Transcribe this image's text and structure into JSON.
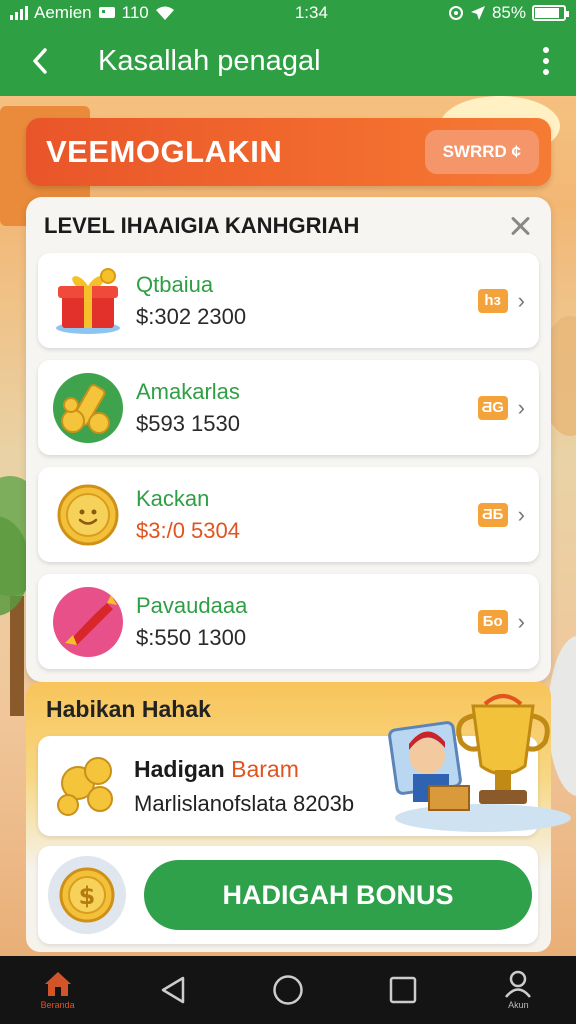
{
  "status_bar": {
    "carrier": "Aemien",
    "network": "110",
    "time": "1:34",
    "battery": "85%",
    "battery_level": 0.85
  },
  "app_bar": {
    "title": "Kasallah penagal",
    "back_icon": "chevron-left-icon",
    "more_icon": "more-vertical-icon"
  },
  "banner": {
    "title": "VEEMOGLAKIN",
    "button_label": "SWRRD ¢"
  },
  "panel": {
    "title": "LEVEL IHAAIGIA KANHGRIAH",
    "close_icon": "close-icon",
    "items": [
      {
        "name": "Qtbaiua",
        "price": "$:302 2300",
        "badge": "hɜ",
        "icon": "gift-box-icon",
        "price_color": "dark"
      },
      {
        "name": "Amakarlas",
        "price": "$593 1530",
        "badge": "ƋG",
        "icon": "gold-bars-icon",
        "price_color": "dark"
      },
      {
        "name": "Kackan",
        "price": "$3:/0 5304",
        "badge": "ƋƂ",
        "icon": "gold-coin-icon",
        "price_color": "orange"
      },
      {
        "name": "Pavaudaaa",
        "price": "$:550 1300",
        "badge": "Ƃo",
        "icon": "candy-icon",
        "price_color": "dark"
      }
    ]
  },
  "bonus": {
    "section_title": "Habikan Hahak",
    "card_title_main": "Hadigan ",
    "card_title_accent": "Baram",
    "card_subtitle": "Marlislanofslata 8203b",
    "cta_label": "HADIGAH BONUS"
  },
  "nav": {
    "items": [
      {
        "label": "Beranda",
        "icon": "home-icon",
        "active": true
      },
      {
        "label": "",
        "icon": "back-triangle-icon",
        "active": false
      },
      {
        "label": "",
        "icon": "home-circle-icon",
        "active": false
      },
      {
        "label": "",
        "icon": "recents-square-icon",
        "active": false
      },
      {
        "label": "Akun",
        "icon": "profile-icon",
        "active": false
      }
    ]
  },
  "colors": {
    "primary_green": "#2f9f44",
    "banner_orange": "#e9552a",
    "badge_orange": "#f3a33a",
    "accent_orange": "#e0541f"
  }
}
